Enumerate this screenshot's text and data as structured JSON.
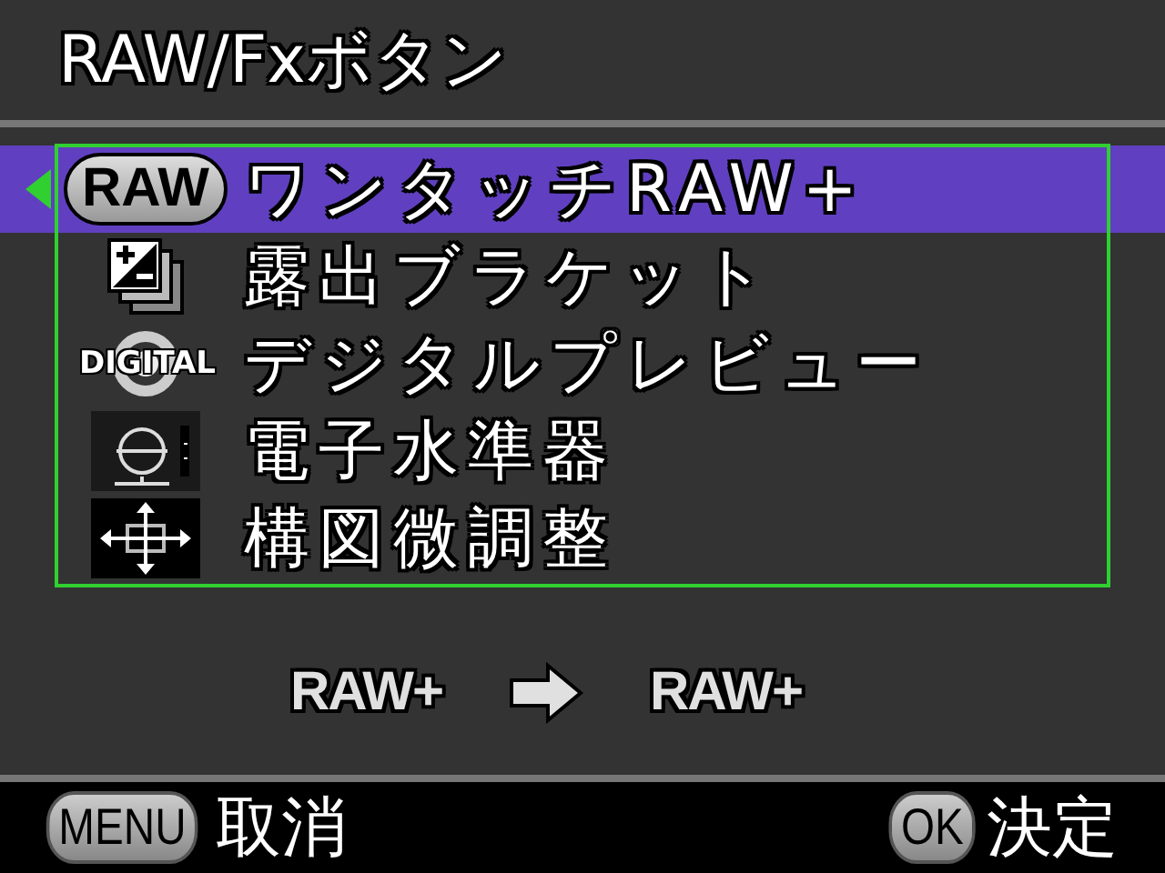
{
  "title": "RAW/Fxボタン",
  "menu_items": [
    {
      "kind": "raw",
      "badge": "RAW",
      "label": "ワンタッチRAW+",
      "selected": true
    },
    {
      "kind": "bracket",
      "label": "露出ブラケット",
      "selected": false
    },
    {
      "kind": "digital",
      "badge": "DIGITAL",
      "label": "デジタルプレビュー",
      "selected": false
    },
    {
      "kind": "level",
      "label": "電子水準器",
      "selected": false
    },
    {
      "kind": "composition",
      "label": "構図微調整",
      "selected": false
    }
  ],
  "setting": {
    "from": "RAW+",
    "to": "RAW+"
  },
  "footer": [
    {
      "key": "MENU",
      "label": "取消"
    },
    {
      "key": "OK",
      "label": "決定"
    }
  ]
}
